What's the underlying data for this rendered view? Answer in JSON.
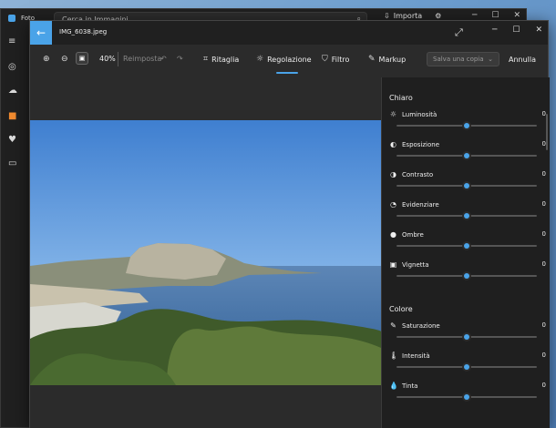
{
  "bg_window": {
    "app_name": "Foto",
    "search_placeholder": "Cerca in Immagini",
    "import_label": "Importa"
  },
  "editor": {
    "file_name": "IMG_6038.jpeg",
    "zoom": "40%",
    "reset_label": "Reimposta",
    "tabs": [
      "Ritaglia",
      "Regolazione",
      "Filtro",
      "Markup"
    ],
    "active_tab": "Regolazione",
    "save_label": "Salva una copia",
    "cancel_label": "Annulla"
  },
  "panel": {
    "sections": [
      {
        "title": "Chiaro",
        "items": [
          {
            "label": "Luminosità",
            "value": "0",
            "icon": "brightness-icon",
            "glyph": "☼",
            "level": 0.5
          },
          {
            "label": "Esposizione",
            "value": "0",
            "icon": "exposure-icon",
            "glyph": "◐",
            "level": 0.5
          },
          {
            "label": "Contrasto",
            "value": "0",
            "icon": "contrast-icon",
            "glyph": "◑",
            "level": 0.5
          },
          {
            "label": "Evidenziare",
            "value": "0",
            "icon": "highlights-icon",
            "glyph": "◔",
            "level": 0.5
          },
          {
            "label": "Ombre",
            "value": "0",
            "icon": "shadows-icon",
            "glyph": "●",
            "level": 0.5
          },
          {
            "label": "Vignetta",
            "value": "0",
            "icon": "vignette-icon",
            "glyph": "▣",
            "level": 0.5
          }
        ]
      },
      {
        "title": "Colore",
        "items": [
          {
            "label": "Saturazione",
            "value": "0",
            "icon": "saturation-icon",
            "glyph": "✎",
            "level": 0.5
          },
          {
            "label": "Intensità",
            "value": "0",
            "icon": "intensity-icon",
            "glyph": "🌡",
            "level": 0.5
          },
          {
            "label": "Tinta",
            "value": "0",
            "icon": "tint-icon",
            "glyph": "💧",
            "level": 0.5
          }
        ]
      }
    ]
  },
  "colors": {
    "accent": "#4aa3e8",
    "panel_bg": "#1f1f1f",
    "window_bg": "#2b2b2b"
  }
}
